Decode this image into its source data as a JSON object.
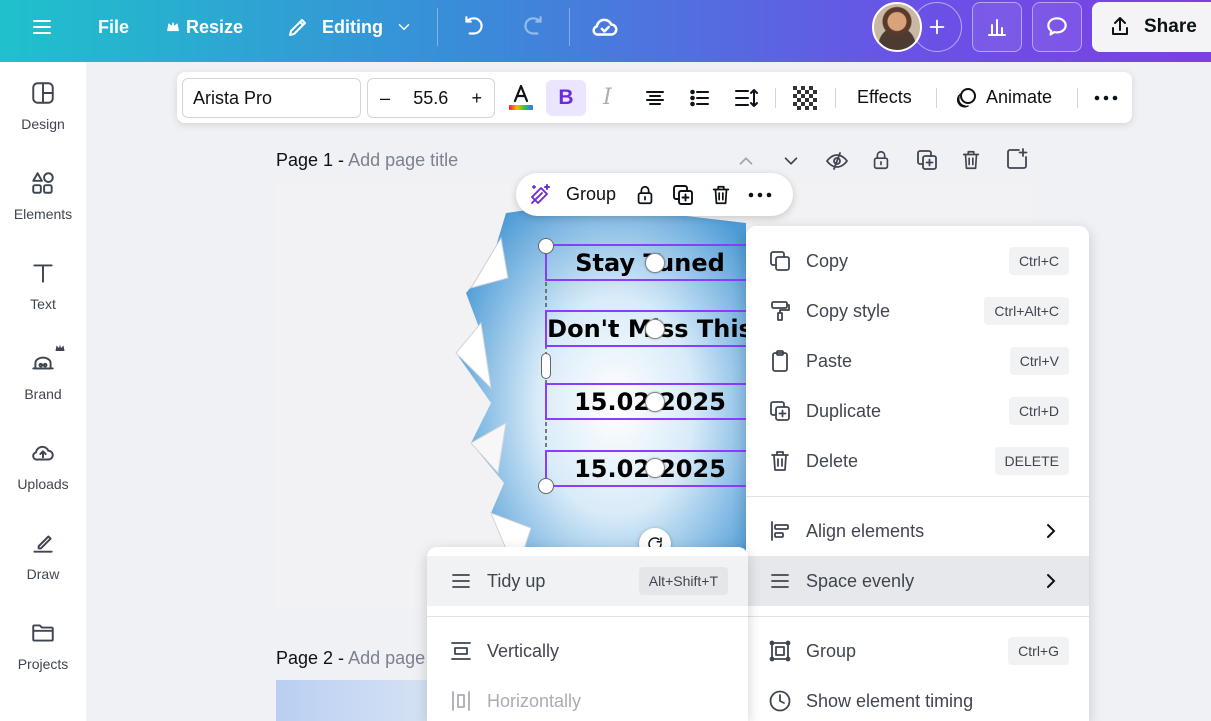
{
  "topbar": {
    "file": "File",
    "resize": "Resize",
    "editing": "Editing",
    "share": "Share"
  },
  "sidebar": {
    "items": [
      {
        "label": "Design",
        "icon": "design-icon"
      },
      {
        "label": "Elements",
        "icon": "elements-icon"
      },
      {
        "label": "Text",
        "icon": "text-icon"
      },
      {
        "label": "Brand",
        "icon": "brand-icon"
      },
      {
        "label": "Uploads",
        "icon": "uploads-icon"
      },
      {
        "label": "Draw",
        "icon": "draw-icon"
      },
      {
        "label": "Projects",
        "icon": "projects-icon"
      }
    ]
  },
  "toolbar": {
    "font_name": "Arista Pro",
    "minus": "–",
    "font_size": "55.6",
    "plus": "+",
    "bold": "B",
    "italic": "I",
    "effects": "Effects",
    "animate": "Animate"
  },
  "page1": {
    "label": "Page 1 - ",
    "placeholder": "Add page title"
  },
  "page2": {
    "label": "Page 2 - ",
    "placeholder": "Add page"
  },
  "canvas": {
    "texts": [
      "Stay Tuned",
      "Don't Miss This",
      "15.02.2025",
      "15.02.2025"
    ]
  },
  "groupbar": {
    "label": "Group"
  },
  "context_menu": {
    "items": [
      {
        "label": "Copy",
        "shortcut": "Ctrl+C"
      },
      {
        "label": "Copy style",
        "shortcut": "Ctrl+Alt+C"
      },
      {
        "label": "Paste",
        "shortcut": "Ctrl+V"
      },
      {
        "label": "Duplicate",
        "shortcut": "Ctrl+D"
      },
      {
        "label": "Delete",
        "shortcut": "DELETE"
      },
      {
        "label": "Align elements"
      },
      {
        "label": "Space evenly"
      },
      {
        "label": "Group",
        "shortcut": "Ctrl+G"
      },
      {
        "label": "Show element timing"
      }
    ]
  },
  "submenu": {
    "items": [
      {
        "label": "Tidy up",
        "shortcut": "Alt+Shift+T"
      },
      {
        "label": "Vertically"
      },
      {
        "label": "Horizontally"
      }
    ]
  },
  "colors": {
    "accent": "#8b3dff",
    "disabled": "#a9adb4"
  }
}
